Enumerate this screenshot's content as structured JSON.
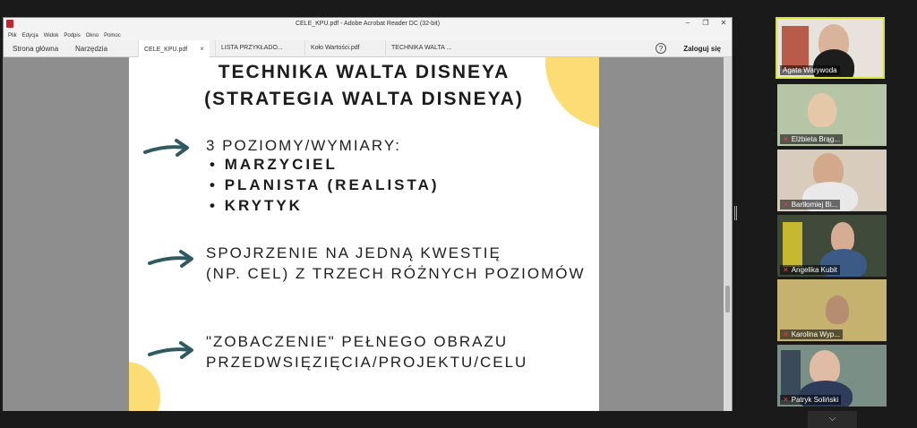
{
  "acrobat": {
    "window_title": "CELE_KPU.pdf - Adobe Acrobat Reader DC (32-bit)",
    "menu": [
      "Plik",
      "Edycja",
      "Widok",
      "Podpis",
      "Okno",
      "Pomoc"
    ],
    "nav": {
      "home": "Strona główna",
      "tools": "Narzędzia"
    },
    "doc_tabs": [
      "CELE_KPU.pdf",
      "LISTA PRZYKŁADO...",
      "Koło Wartości.pdf",
      "TECHNIKA WALTA ..."
    ],
    "signin": "Zaloguj się",
    "help_glyph": "?",
    "win_controls": [
      "–",
      "❐",
      "✕"
    ]
  },
  "slide": {
    "title_line1": "TECHNIKA WALTA DISNEYA",
    "title_line2": "(STRATEGIA WALTA DISNEYA)",
    "point1_intro": "3 POZIOMY/WYMIARY:",
    "point1_bullets": [
      "MARZYCIEL",
      "PLANISTA (REALISTA)",
      "KRYTYK"
    ],
    "point2_line1": "SPOJRZENIE NA JEDNĄ KWESTIĘ",
    "point2_line2": "(NP. CEL) Z TRZECH RÓŻNYCH POZIOMÓW",
    "point3_line1": "\"ZOBACZENIE\" PEŁNEGO OBRAZU",
    "point3_line2": "PRZEDWSIĘZIĘCIA/PROJEKTU/CELU",
    "accent_color": "#fbdc75",
    "arrow_color": "#2f5a62",
    "arrow_icon": "arrow-right-icon"
  },
  "participants": [
    {
      "name": "Agata Warywoda",
      "muted": false,
      "active": true
    },
    {
      "name": "Elżbieta Brąg...",
      "muted": true,
      "active": false
    },
    {
      "name": "Bartłomiej Bi...",
      "muted": true,
      "active": false
    },
    {
      "name": "Angelika Kubit",
      "muted": true,
      "active": false
    },
    {
      "name": "Karolina Wyp...",
      "muted": true,
      "active": false
    },
    {
      "name": "Patryk Soliński",
      "muted": true,
      "active": false
    }
  ],
  "scroll_down_icon": "chevron-down-icon",
  "scroll_down_glyph": "⌵"
}
